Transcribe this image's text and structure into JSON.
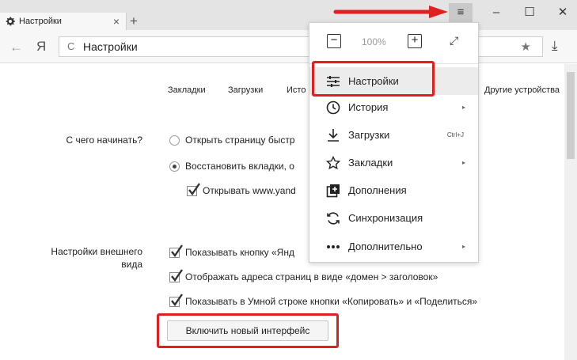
{
  "browser": {
    "tab_title": "Настройки",
    "tab_close": "×",
    "new_tab": "+",
    "menu_button": "≡",
    "minimize": "–",
    "maximize": "☐",
    "close": "✕",
    "back": "←",
    "logo": "Я",
    "reload": "C",
    "address": "Настройки",
    "bookmark_star": "★",
    "download": "⤓"
  },
  "settings_nav": [
    "Закладки",
    "Загрузки",
    "Исто",
    "Другие устройства"
  ],
  "start_section": {
    "label": "С чего начинать?",
    "options": [
      {
        "label": "Открыть страницу быстр",
        "type": "radio",
        "selected": false
      },
      {
        "label": "Восстановить вкладки, о",
        "type": "radio",
        "selected": true
      },
      {
        "label": "Открывать www.yand",
        "type": "checkbox",
        "checked": true
      }
    ]
  },
  "appearance_section": {
    "label_line1": "Настройки внешнего",
    "label_line2": "вида",
    "options": [
      {
        "label": "Показывать кнопку «Янд",
        "checked": true
      },
      {
        "label": "Отображать адреса страниц в виде «домен > заголовок»",
        "checked": true
      },
      {
        "label": "Показывать в Умной строке кнопки «Копировать» и «Поделиться»",
        "checked": true
      }
    ],
    "new_ui_button": "Включить новый интерфейс"
  },
  "menu": {
    "zoom_minus": "−",
    "zoom_value": "100%",
    "zoom_plus": "+",
    "fullscreen": "⤢",
    "items": [
      {
        "label": "Настройки",
        "icon": "sliders-icon",
        "active": true
      },
      {
        "label": "История",
        "icon": "clock-icon",
        "submenu": "▸"
      },
      {
        "label": "Загрузки",
        "icon": "download-icon",
        "shortcut": "Ctrl+J"
      },
      {
        "label": "Закладки",
        "icon": "star-icon",
        "submenu": "▸"
      },
      {
        "label": "Дополнения",
        "icon": "extensions-icon"
      },
      {
        "label": "Синхронизация",
        "icon": "sync-icon"
      },
      {
        "label": "Дополнительно",
        "icon": "more-icon",
        "submenu": "▸"
      }
    ]
  },
  "colors": {
    "annotation": "#e02020",
    "menu_active": "#ececec"
  }
}
